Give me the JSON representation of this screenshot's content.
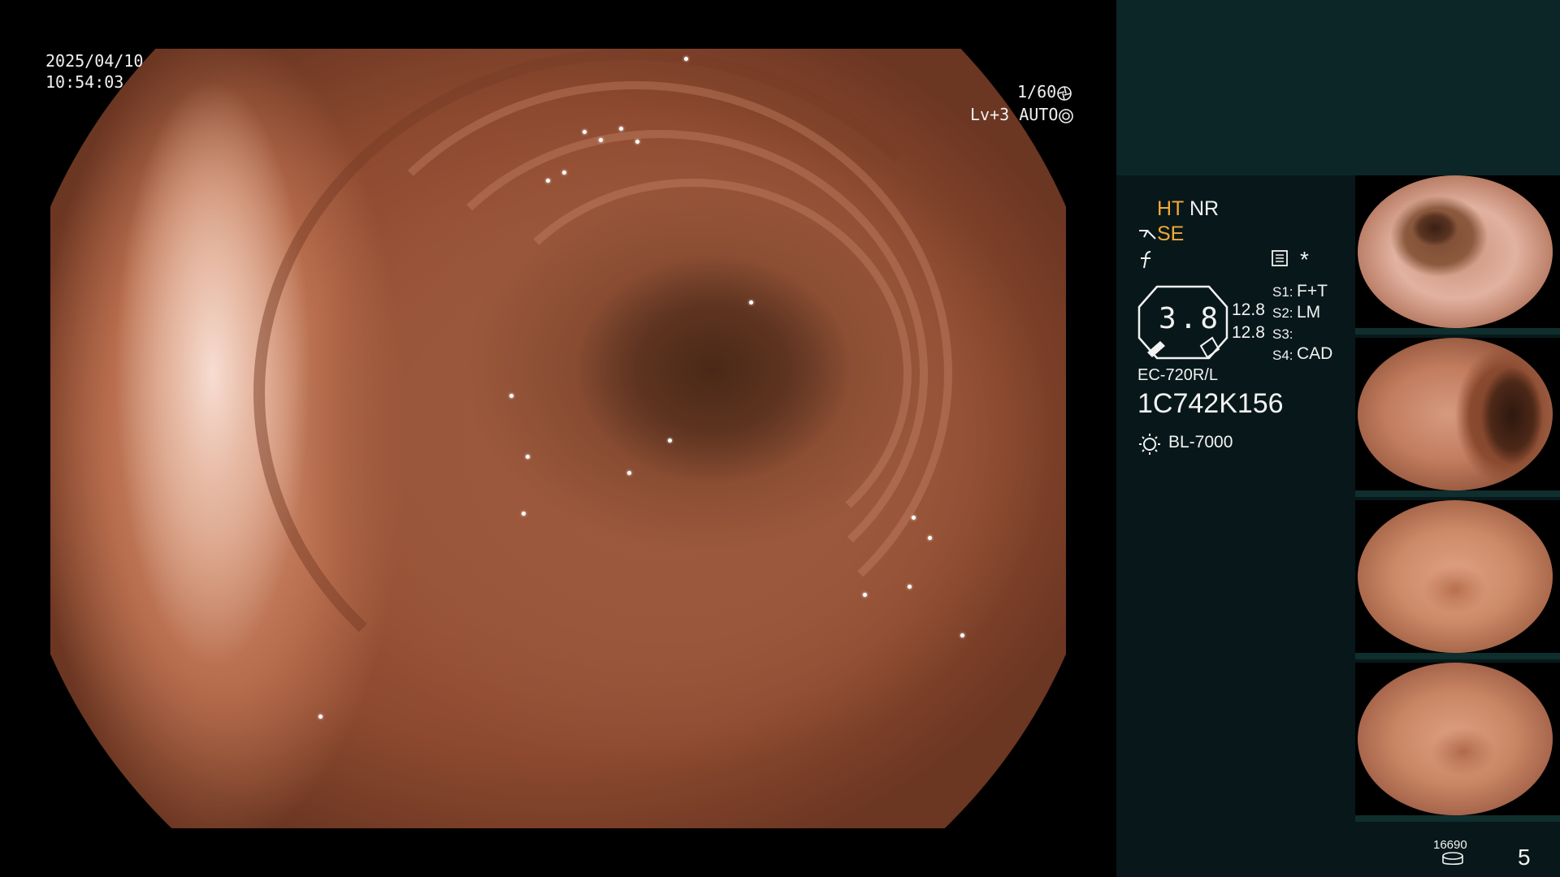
{
  "overlay": {
    "date": "2025/04/10",
    "time": "10:54:03",
    "shutter": "1/60",
    "level": "Lv+3",
    "iris": "AUTO"
  },
  "panel": {
    "ht_label": "HT",
    "nr_label": "NR",
    "se_label": "SE",
    "star": "*",
    "zoom_value": "3.8",
    "value_upper": "12.8",
    "value_lower": "12.8",
    "s1_key": "S1:",
    "s1_value": "F+T",
    "s2_key": "S2:",
    "s2_value": "LM",
    "s3_key": "S3:",
    "s3_value": "",
    "s4_key": "S4:",
    "s4_value": "CAD",
    "scope_model": "EC-720R/L",
    "scope_serial": "1C742K156",
    "light_source": "BL-7000",
    "storage_count": "16690",
    "image_count": "5"
  },
  "colors": {
    "panel_top": "#0c2628",
    "panel": "#08181a",
    "amber_text": "#f2a93a",
    "overlay_text": "#f0f0f0"
  },
  "thumbnails": {
    "count": 4
  }
}
